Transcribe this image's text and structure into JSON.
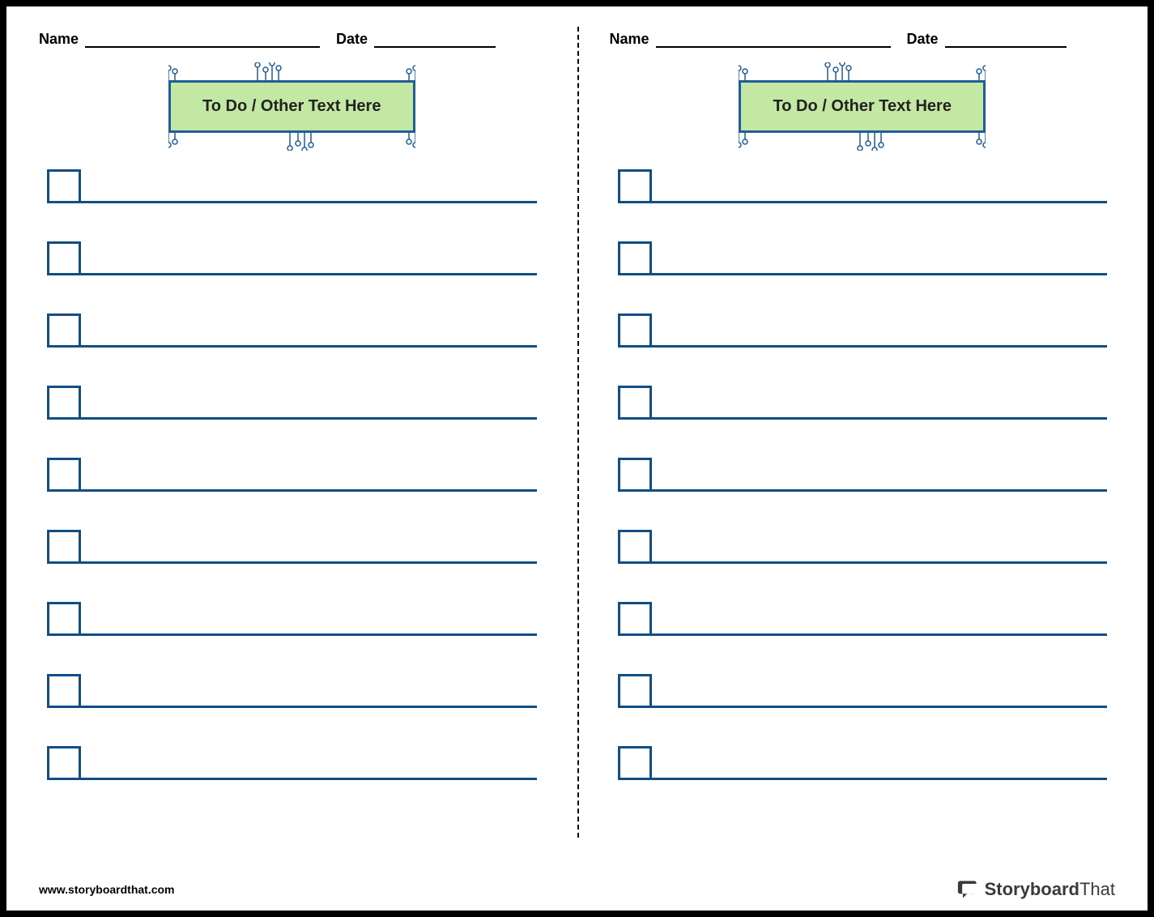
{
  "header": {
    "name_label": "Name",
    "date_label": "Date"
  },
  "title": "To Do / Other Text Here",
  "item_count": 9,
  "footer": {
    "url": "www.storyboardthat.com",
    "brand_main": "Storyboard",
    "brand_sub": "That"
  },
  "colors": {
    "accent": "#1f5e9a",
    "fill": "#c3e8a4",
    "line": "#104e84"
  }
}
